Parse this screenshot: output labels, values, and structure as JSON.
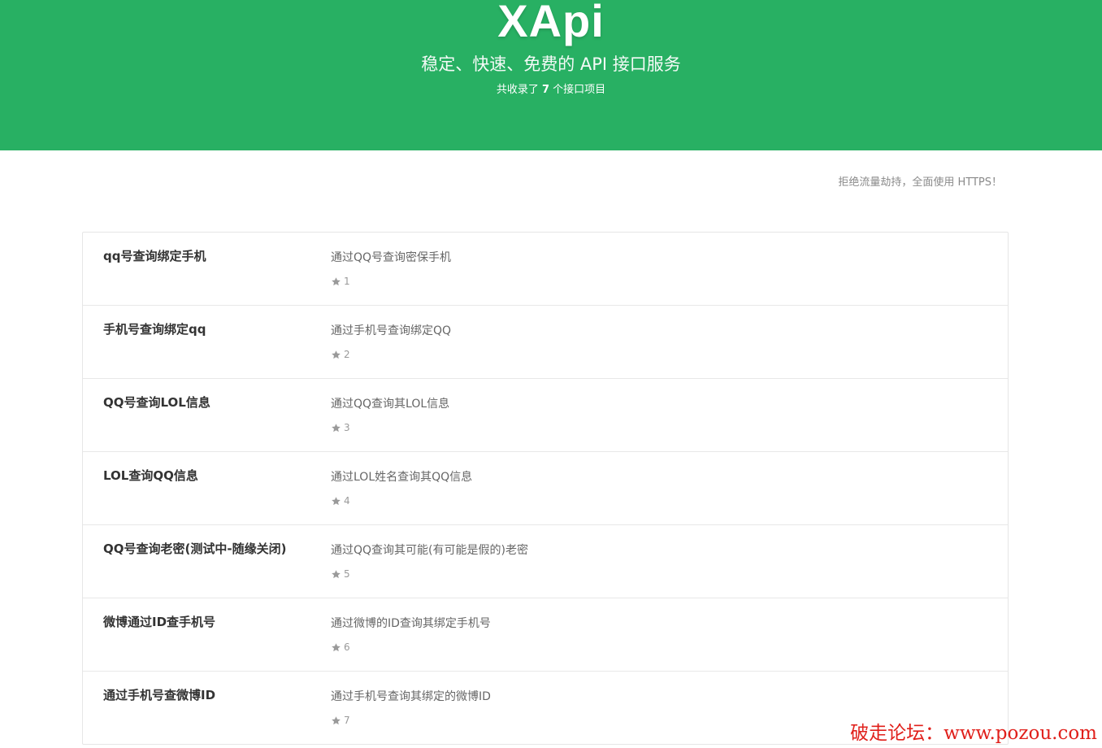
{
  "header": {
    "title": "XApi",
    "subtitle": "稳定、快速、免费的 API 接口服务",
    "count_prefix": "共收录了",
    "count_value": "7",
    "count_suffix": "个接口项目",
    "background_color": "#28b063"
  },
  "notice": "拒绝流量劫持，全面使用 HTTPS！",
  "apis": [
    {
      "name": "qq号查询绑定手机",
      "description": "通过QQ号查询密保手机",
      "id": "1"
    },
    {
      "name": "手机号查询绑定qq",
      "description": "通过手机号查询绑定QQ",
      "id": "2"
    },
    {
      "name": "QQ号查询LOL信息",
      "description": "通过QQ查询其LOL信息",
      "id": "3"
    },
    {
      "name": "LOL查询QQ信息",
      "description": "通过LOL姓名查询其QQ信息",
      "id": "4"
    },
    {
      "name": "QQ号查询老密(测试中-随缘关闭)",
      "description": "通过QQ查询其可能(有可能是假的)老密",
      "id": "5"
    },
    {
      "name": "微博通过ID查手机号",
      "description": "通过微博的ID查询其绑定手机号",
      "id": "6"
    },
    {
      "name": "通过手机号查微博ID",
      "description": "通过手机号查询其绑定的微博ID",
      "id": "7"
    }
  ],
  "icons": {
    "row_meta": "star-icon"
  },
  "watermark": "破走论坛：www.pozou.com"
}
